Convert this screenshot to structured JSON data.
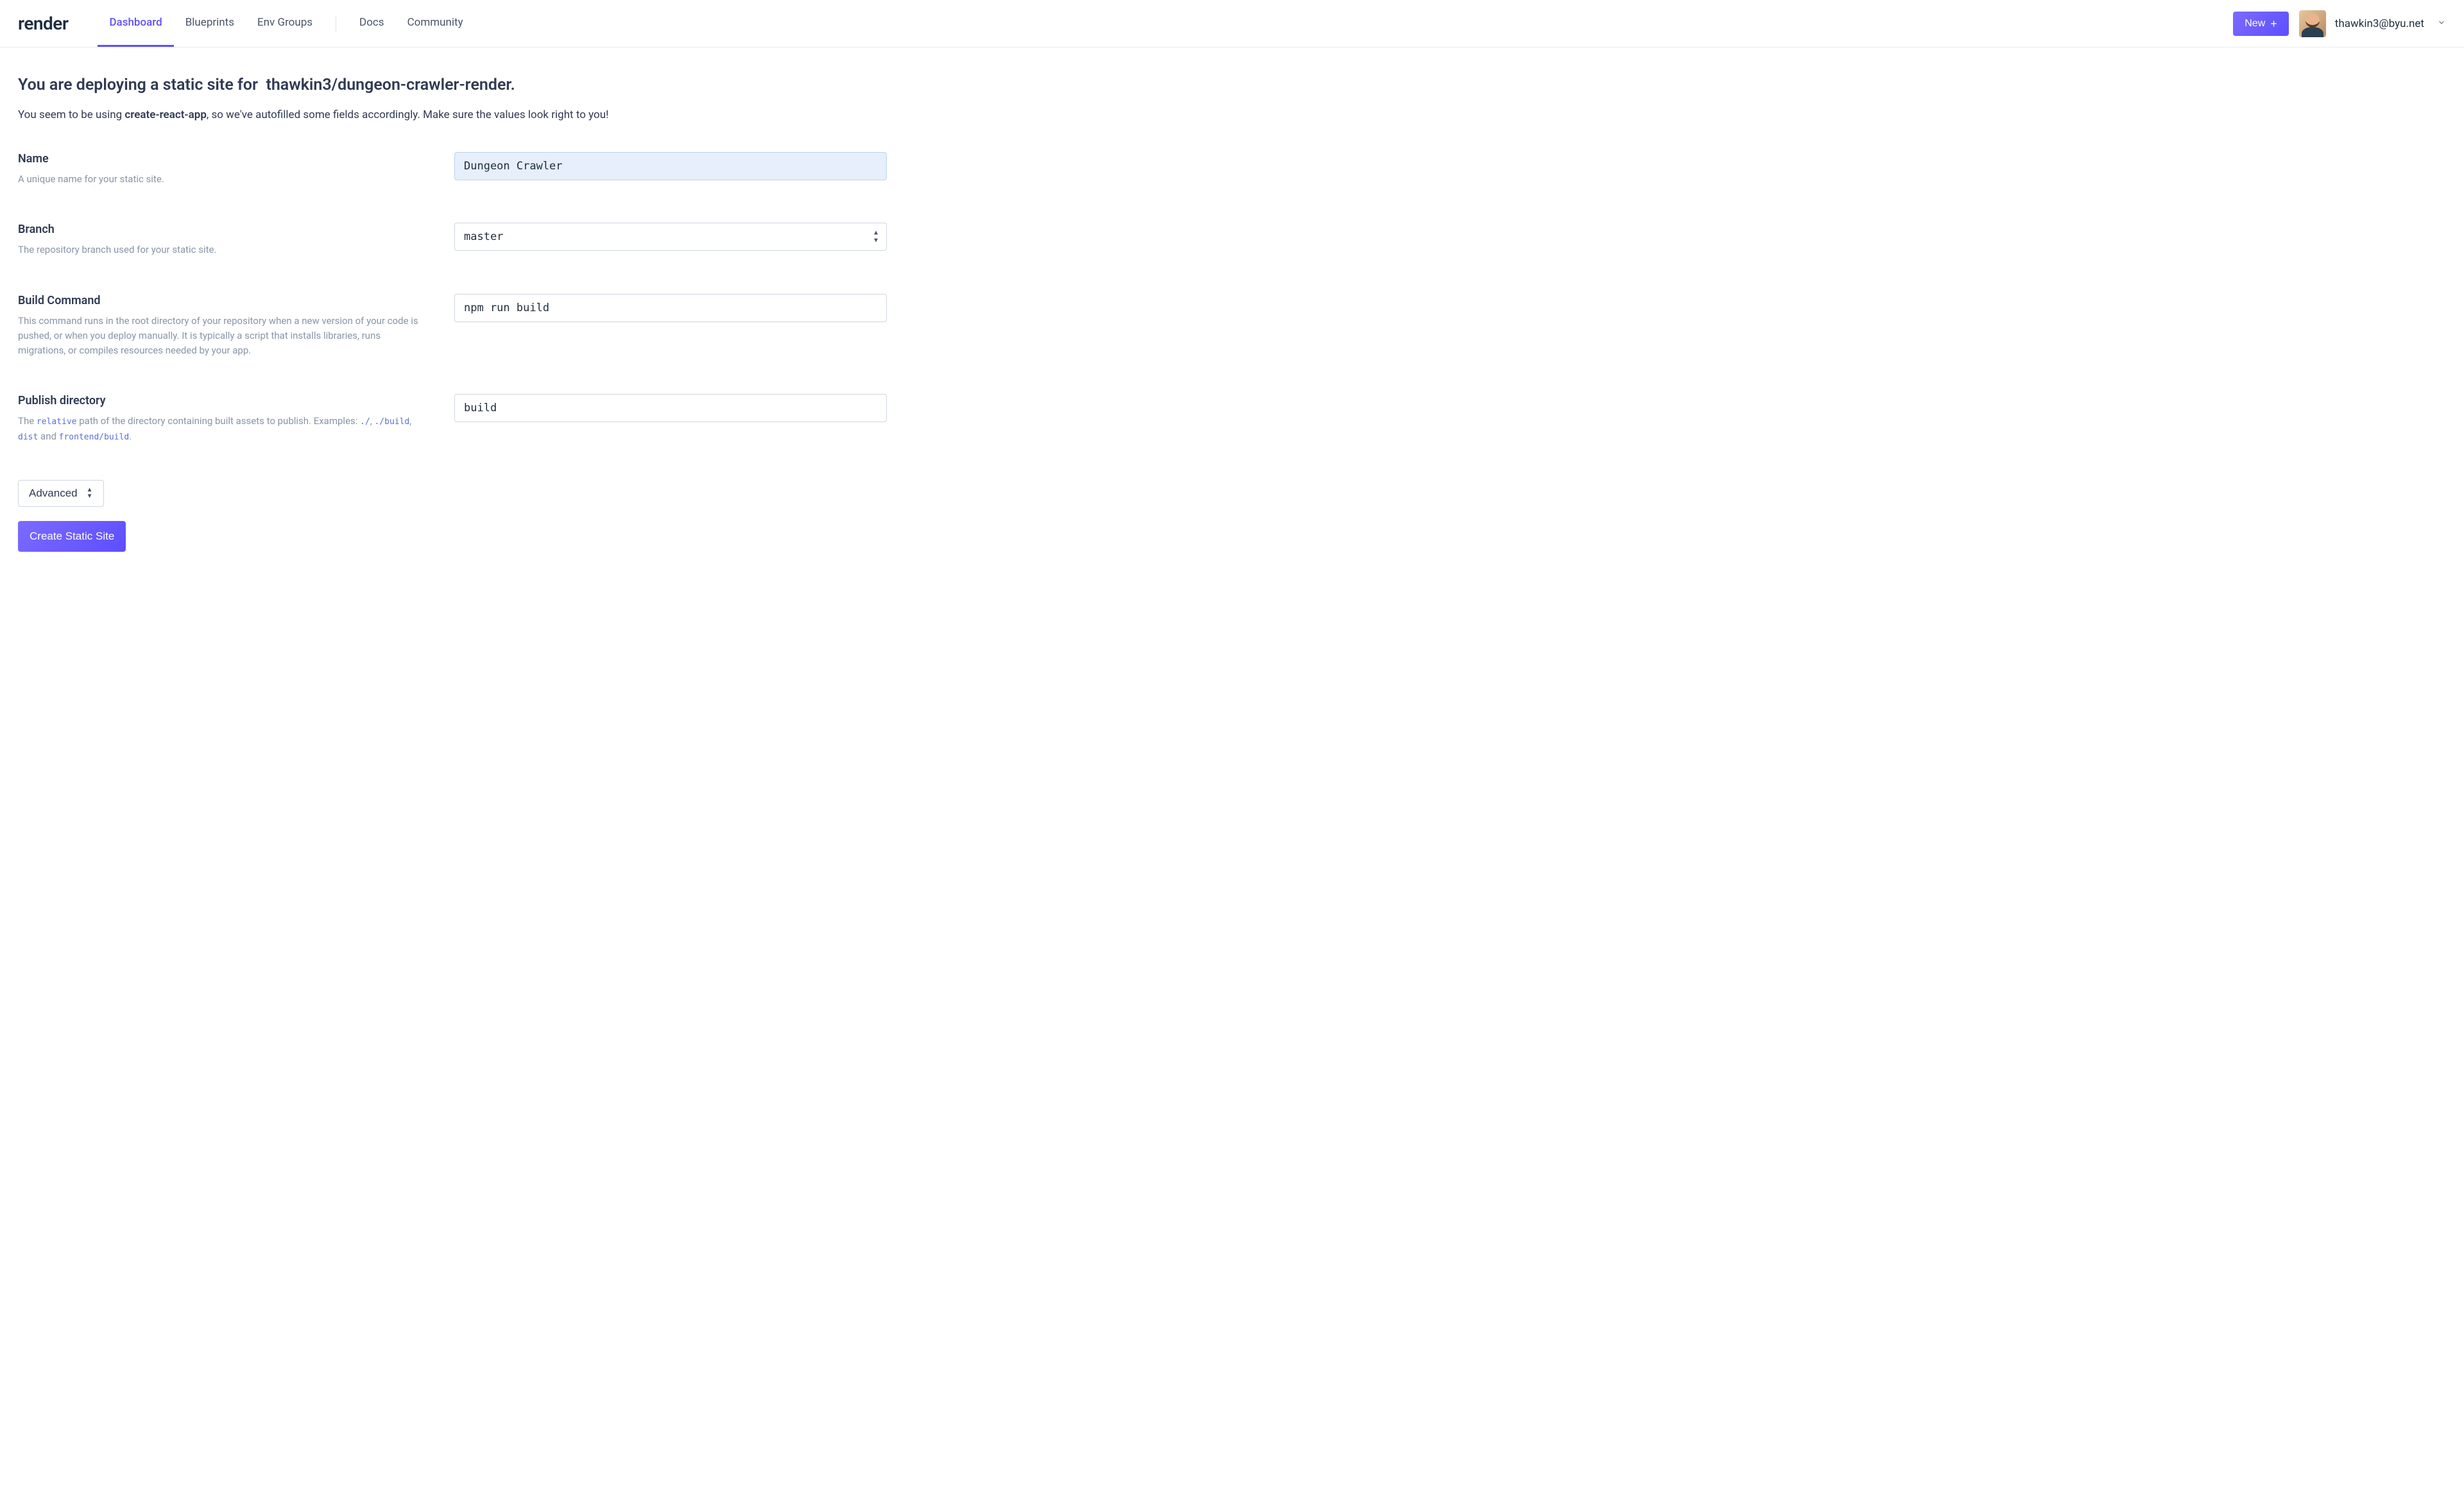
{
  "logo": "render",
  "nav": {
    "dashboard": "Dashboard",
    "blueprints": "Blueprints",
    "envgroups": "Env Groups",
    "docs": "Docs",
    "community": "Community"
  },
  "header": {
    "new_label": "New",
    "user_email": "thawkin3@byu.net"
  },
  "page": {
    "heading_prefix": "You are deploying a static site for ",
    "heading_repo": "thawkin3/dungeon-crawler-render.",
    "sub_prefix": "You seem to be using ",
    "sub_bold": "create-react-app",
    "sub_suffix": ", so we've autofilled some fields accordingly. Make sure the values look right to you!"
  },
  "fields": {
    "name": {
      "label": "Name",
      "help": "A unique name for your static site.",
      "value": "Dungeon Crawler"
    },
    "branch": {
      "label": "Branch",
      "help": "The repository branch used for your static site.",
      "value": "master"
    },
    "build": {
      "label": "Build Command",
      "help": "This command runs in the root directory of your repository when a new version of your code is pushed, or when you deploy manually. It is typically a script that installs libraries, runs migrations, or compiles resources needed by your app.",
      "value": "npm run build"
    },
    "publish": {
      "label": "Publish directory",
      "help_prefix": "The ",
      "help_code1": "relative",
      "help_mid": " path of the directory containing built assets to publish. Examples: ",
      "help_code2": "./",
      "help_comma1": ", ",
      "help_code3": "./build",
      "help_comma2": ", ",
      "help_code4": "dist",
      "help_and": " and ",
      "help_code5": "frontend/build",
      "help_end": ".",
      "value": "build"
    }
  },
  "footer": {
    "advanced": "Advanced",
    "create": "Create Static Site"
  }
}
